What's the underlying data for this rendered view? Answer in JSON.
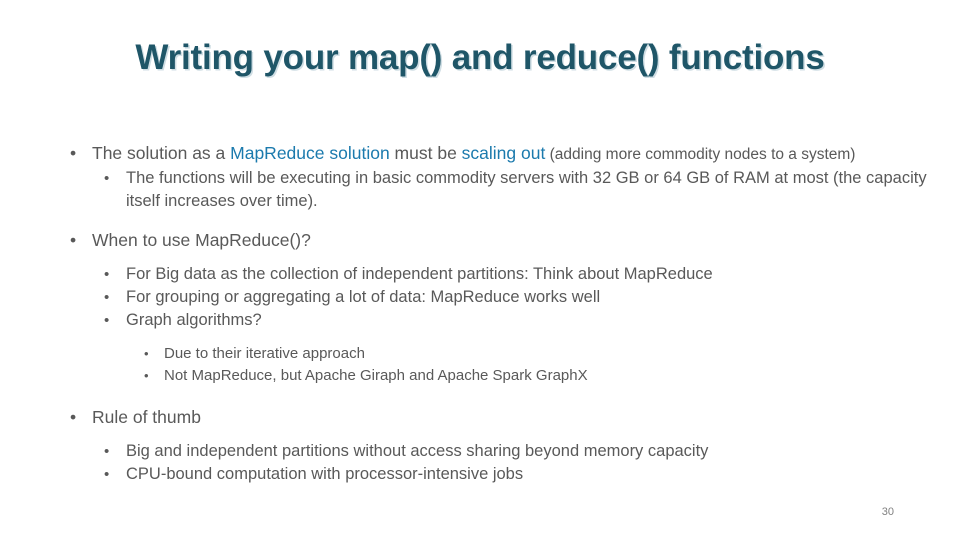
{
  "slide": {
    "title": "Writing your map() and reduce() functions",
    "page_number": "30",
    "colors": {
      "title": "#1F5668",
      "body_text": "#595959",
      "accent_blue": "#1B7AAD",
      "background": "#ffffff"
    },
    "bullet_marker": "•",
    "content": {
      "b1_part1": "The solution as a ",
      "b1_accent1": "MapReduce solution",
      "b1_part2": " must be ",
      "b1_accent2": "scaling out",
      "b1_part3": " (adding more commodity nodes to a system)",
      "b1_sub1": "The functions will be executing in basic commodity servers with 32 GB or 64 GB of RAM at most (the capacity itself increases over time).",
      "b2": "When to use MapReduce()?",
      "b2_sub1": "For Big data as the collection of independent partitions: Think about MapReduce",
      "b2_sub2": "For grouping or aggregating a lot of data: MapReduce works well",
      "b2_sub3": "Graph algorithms?",
      "b2_sub3_a": "Due to their iterative approach",
      "b2_sub3_b": "Not MapReduce, but Apache Giraph and Apache Spark GraphX",
      "b3": "Rule of thumb",
      "b3_sub1": "Big and independent partitions without access sharing beyond memory capacity",
      "b3_sub2": "CPU-bound computation with processor-intensive jobs"
    }
  }
}
